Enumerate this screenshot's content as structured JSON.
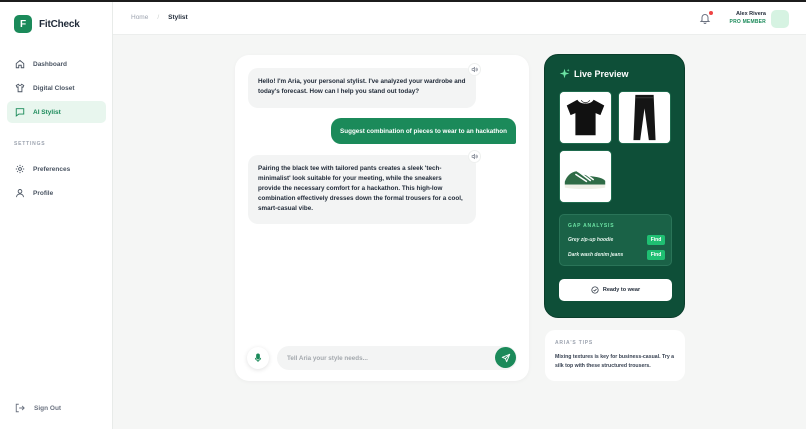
{
  "app": {
    "logo_letter": "F",
    "name": "FitCheck"
  },
  "sidebar": {
    "items": [
      {
        "label": "Dashboard",
        "icon": "home-icon"
      },
      {
        "label": "Digital Closet",
        "icon": "shirt-icon"
      },
      {
        "label": "AI Stylist",
        "icon": "chat-icon",
        "active": true
      }
    ],
    "settings_heading": "SETTINGS",
    "settings_items": [
      {
        "label": "Preferences",
        "icon": "gear-icon"
      },
      {
        "label": "Profile",
        "icon": "user-icon"
      }
    ],
    "sign_out": "Sign Out"
  },
  "header": {
    "breadcrumb": {
      "home": "Home",
      "separator": "/",
      "current": "Stylist"
    },
    "user": {
      "name": "Alex Rivera",
      "role": "PRO MEMBER"
    }
  },
  "chat": {
    "messages": [
      {
        "from": "ai",
        "text": "Hello! I'm Aria, your personal stylist. I've analyzed your wardrobe and today's forecast. How can I help you stand out today?"
      },
      {
        "from": "user",
        "text": "Suggest combination of pieces to wear to an hackathon"
      },
      {
        "from": "ai",
        "text": "Pairing the black tee with tailored pants creates a sleek 'tech-minimalist' look suitable for your meeting, while the sneakers provide the necessary comfort for a hackathon. This high-low combination effectively dresses down the formal trousers for a cool, smart-casual vibe."
      }
    ],
    "input_placeholder": "Tell Aria your style needs..."
  },
  "preview": {
    "title": "Live Preview",
    "items": [
      "black-tshirt",
      "black-pants",
      "green-sneaker"
    ],
    "gap_analysis": {
      "title": "GAP ANALYSIS",
      "items": [
        {
          "label": "Grey zip-up hoodie",
          "action": "Find"
        },
        {
          "label": "Dark wash denim jeans",
          "action": "Find"
        }
      ]
    },
    "ready_label": "Ready to wear"
  },
  "tips": {
    "title": "ARIA'S TIPS",
    "text": "Mixing textures is key for business-casual. Try a silk top with these structured trousers."
  },
  "colors": {
    "accent": "#1b8a5a",
    "preview_bg": "#0e4f38",
    "find": "#1fbf72"
  }
}
